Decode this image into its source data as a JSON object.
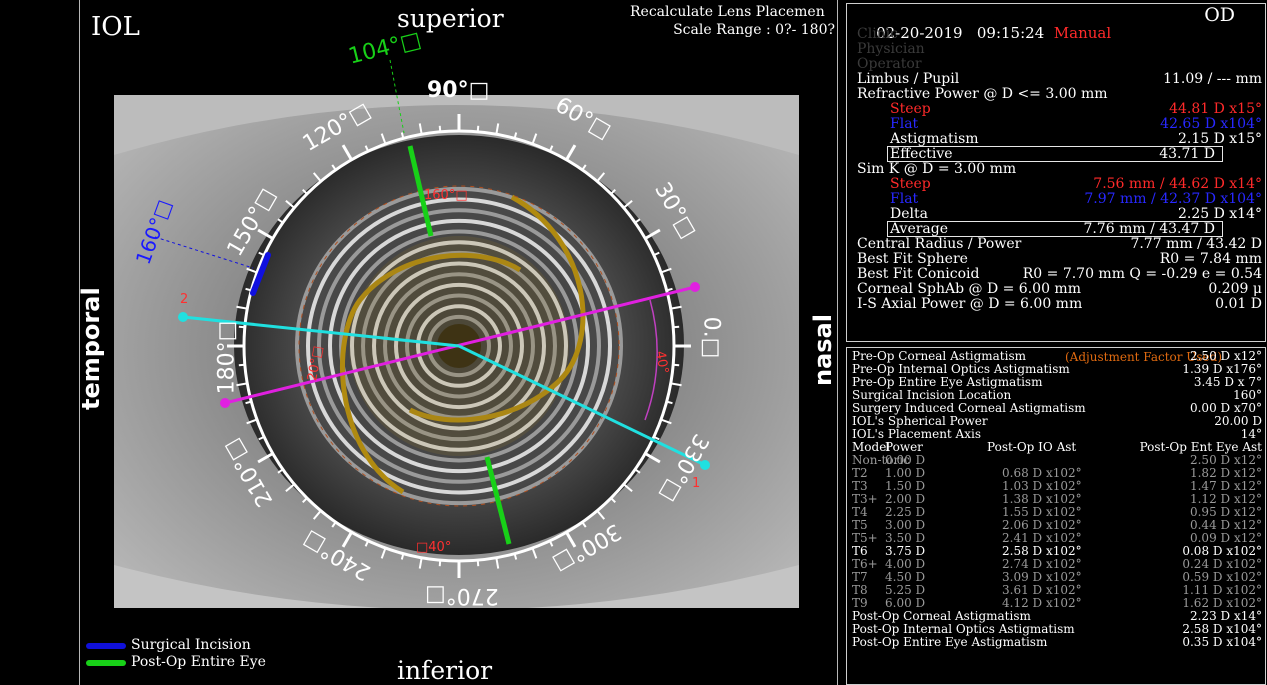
{
  "header": {
    "mode_label": "IOL",
    "direction_superior": "superior",
    "direction_inferior": "inferior",
    "direction_temporal": "temporal",
    "direction_nasal": "nasal",
    "recalc_title": "Recalculate Lens Placemen",
    "scale_range": "Scale Range : 0?- 180?"
  },
  "dial": {
    "angles": [
      "90°□",
      "60°□",
      "30°□",
      "0.□",
      "330°□",
      "300°□",
      "270°□",
      "240°□",
      "210°□",
      "180°□",
      "150°□",
      "120°□"
    ],
    "green_marker": "104°□",
    "blue_marker": "160°□",
    "red_160": "160°□",
    "red_20": "20°□",
    "red_40": "40°",
    "red_140": "□40°",
    "point_2": "2",
    "point_1": "1"
  },
  "legend": {
    "incision_label": "Surgical Incision",
    "postop_label": "Post-Op Entire Eye",
    "incision_color": "#1010d8",
    "postop_color": "#18d018"
  },
  "topright": {
    "date": "02-20-2019",
    "time": "09:15:24",
    "mode": "Manual",
    "eye": "OD",
    "clinic": "Clinic",
    "physician": "Physician",
    "operator": "Operator",
    "limbus_label": "Limbus / Pupil",
    "limbus_value": "11.09 / --- mm",
    "refr_label": "Refractive Power @ D <= 3.00 mm",
    "steep_label": "Steep",
    "steep_value": "44.81 D x15°",
    "flat_label": "Flat",
    "flat_value": "42.65 D x104°",
    "astig_label": "Astigmatism",
    "astig_value": "2.15 D x15°",
    "effective_label": "Effective",
    "effective_value": "43.71 D",
    "simk_label": "Sim K @ D = 3.00 mm",
    "simk_steep_label": "Steep",
    "simk_steep_value": "7.56 mm / 44.62 D x14°",
    "simk_flat_label": "Flat",
    "simk_flat_value": "7.97 mm / 42.37 D x104°",
    "delta_label": "Delta",
    "delta_value": "2.25 D x14°",
    "average_label": "Average",
    "average_value": "7.76 mm / 43.47 D",
    "central_label": "Central Radius / Power",
    "central_value": "7.77 mm / 43.42 D",
    "bfs_label": "Best Fit Sphere",
    "bfs_value": "R0 = 7.84 mm",
    "bfc_label": "Best Fit Conicoid",
    "bfc_value": "R0 = 7.70 mm Q = -0.29 e = 0.54",
    "sphab_label": "Corneal SphAb @ D = 6.00 mm",
    "sphab_value": "0.209 μ",
    "is_label": "I-S Axial Power @ D = 6.00 mm",
    "is_value": "0.01 D"
  },
  "bottomright": {
    "rows": [
      {
        "label": "Pre-Op Corneal Astigmatism",
        "value": "2.50 D x12°"
      },
      {
        "label": "Pre-Op Internal Optics Astigmatism",
        "value": "1.39 D x176°"
      },
      {
        "label": "Pre-Op Entire Eye Astigmatism",
        "value": "3.45 D x 7°"
      },
      {
        "label": "Surgical Incision Location",
        "value": "160°"
      },
      {
        "label": "Surgery Induced Corneal Astigmatism",
        "value": "0.00 D x70°"
      },
      {
        "label": "IOL's Spherical Power",
        "value": "20.00 D"
      },
      {
        "label": "IOL's Placement Axis",
        "value": "14°"
      }
    ],
    "adjustment_factor": "(Adjustment Factor Used)",
    "columns": [
      "Model",
      "Power",
      "Post-Op IO Ast",
      "Post-Op Ent Eye Ast"
    ],
    "toric_rows": [
      {
        "model": "Non-toric",
        "power": "0.00 D",
        "io": "",
        "ent": "2.50 D x12°",
        "highlight": false
      },
      {
        "model": "T2",
        "power": "1.00 D",
        "io": "0.68 D x102°",
        "ent": "1.82 D x12°",
        "highlight": false
      },
      {
        "model": "T3",
        "power": "1.50 D",
        "io": "1.03 D x102°",
        "ent": "1.47 D x12°",
        "highlight": false
      },
      {
        "model": "T3+",
        "power": "2.00 D",
        "io": "1.38 D x102°",
        "ent": "1.12 D x12°",
        "highlight": false
      },
      {
        "model": "T4",
        "power": "2.25 D",
        "io": "1.55 D x102°",
        "ent": "0.95 D x12°",
        "highlight": false
      },
      {
        "model": "T5",
        "power": "3.00 D",
        "io": "2.06 D x102°",
        "ent": "0.44 D x12°",
        "highlight": false
      },
      {
        "model": "T5+",
        "power": "3.50 D",
        "io": "2.41 D x102°",
        "ent": "0.09 D x12°",
        "highlight": false
      },
      {
        "model": "T6",
        "power": "3.75 D",
        "io": "2.58 D x102°",
        "ent": "0.08 D x102°",
        "highlight": true
      },
      {
        "model": "T6+",
        "power": "4.00 D",
        "io": "2.74 D x102°",
        "ent": "0.24 D x102°",
        "highlight": false
      },
      {
        "model": "T7",
        "power": "4.50 D",
        "io": "3.09 D x102°",
        "ent": "0.59 D x102°",
        "highlight": false
      },
      {
        "model": "T8",
        "power": "5.25 D",
        "io": "3.61 D x102°",
        "ent": "1.11 D x102°",
        "highlight": false
      },
      {
        "model": "T9",
        "power": "6.00 D",
        "io": "4.12 D x102°",
        "ent": "1.62 D x102°",
        "highlight": false
      }
    ],
    "post_rows": [
      {
        "label": "Post-Op Corneal Astigmatism",
        "value": "2.23 D x14°"
      },
      {
        "label": "Post-Op Internal Optics Astigmatism",
        "value": "2.58 D x104°"
      },
      {
        "label": "Post-Op Entire Eye Astigmatism",
        "value": "0.35 D x104°"
      }
    ]
  }
}
